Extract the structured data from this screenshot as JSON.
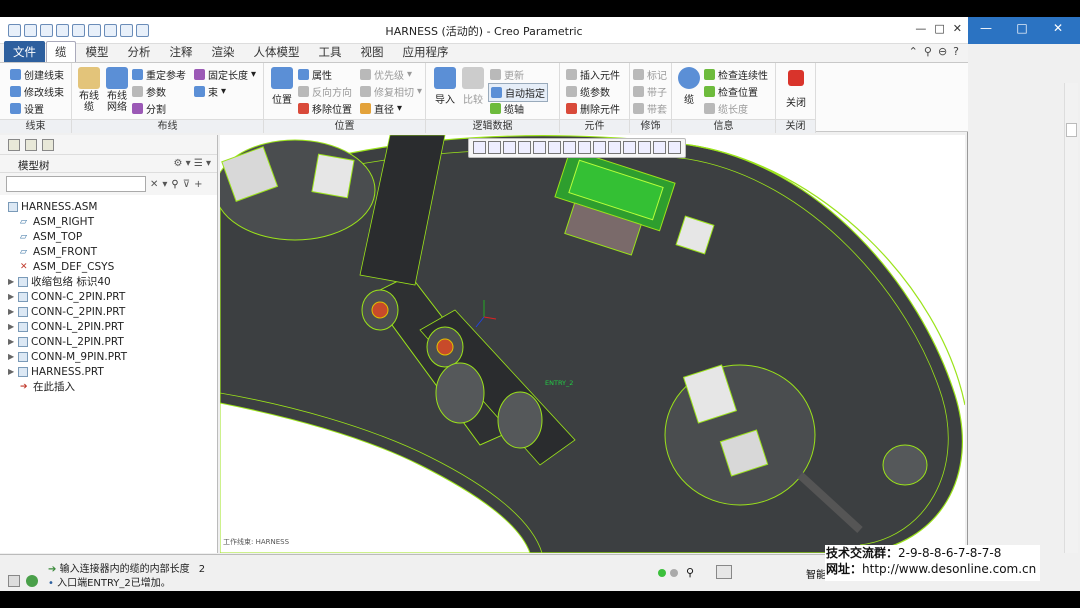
{
  "window": {
    "title": "HARNESS (活动的) - Creo Parametric",
    "close": "✕",
    "minimize": "—",
    "maximize": "□"
  },
  "menu": {
    "tabs": [
      "文件",
      "缆",
      "模型",
      "分析",
      "注释",
      "渲染",
      "人体模型",
      "工具",
      "视图",
      "应用程序"
    ]
  },
  "ribbon": {
    "harness": {
      "create": "创建线束",
      "modify": "修改线束",
      "setup": "设置",
      "footer": "线束"
    },
    "routing": {
      "cable": "布线缆",
      "network": "布线网络",
      "reref": "重定参考",
      "params": "参数",
      "split": "分割",
      "fixlen": "固定长度",
      "bundle": "束",
      "footer": "布线"
    },
    "location": {
      "pos": "位置",
      "prop": "属性",
      "reverse": "反向方向",
      "movepos": "移除位置",
      "priority": "优先级",
      "repair": "修复相切",
      "straight": "直径",
      "footer": "位置"
    },
    "logical": {
      "import": "导入",
      "compare": "比较",
      "update": "更新",
      "auto": "自动指定",
      "axis": "缆轴",
      "footer": "逻辑数据"
    },
    "component": {
      "insert": "插入元件",
      "cableparam": "缆参数",
      "delete": "删除元件",
      "footer": "元件"
    },
    "decor": {
      "mark": "标记",
      "tape": "带子",
      "sleeve": "带套",
      "footer": "修饰"
    },
    "info": {
      "cable": "缆",
      "check": "检查连续性",
      "checkpos": "检查位置",
      "length": "缆长度",
      "footer": "信息"
    },
    "close": {
      "label": "关闭",
      "footer": "关闭"
    }
  },
  "tree": {
    "header": "模型树",
    "items": [
      {
        "label": "HARNESS.ASM",
        "type": "asm"
      },
      {
        "label": "ASM_RIGHT",
        "type": "plane"
      },
      {
        "label": "ASM_TOP",
        "type": "plane"
      },
      {
        "label": "ASM_FRONT",
        "type": "plane"
      },
      {
        "label": "ASM_DEF_CSYS",
        "type": "csys"
      },
      {
        "label": "收缩包络 标识40",
        "type": "part"
      },
      {
        "label": "CONN-C_2PIN.PRT",
        "type": "part"
      },
      {
        "label": "CONN-C_2PIN.PRT",
        "type": "part"
      },
      {
        "label": "CONN-L_2PIN.PRT",
        "type": "part"
      },
      {
        "label": "CONN-L_2PIN.PRT",
        "type": "part"
      },
      {
        "label": "CONN-M_9PIN.PRT",
        "type": "part"
      },
      {
        "label": "HARNESS.PRT",
        "type": "part"
      },
      {
        "label": "在此插入",
        "type": "insert"
      }
    ]
  },
  "viewport": {
    "workset": "工作线束: HARNESS",
    "entry_label": "ENTRY_2"
  },
  "status": {
    "line1": "输入连接器内的缆的内部长度",
    "line1_value": "2",
    "line2": "入口端ENTRY_2已增加。",
    "smart": "智能"
  },
  "overlay": {
    "line1_label": "技术交流群：",
    "line1_value": "2-9-8-8-6-7-8-7-8",
    "line2_label": "网址：",
    "line2_value": "http://www.desonline.com.cn"
  }
}
